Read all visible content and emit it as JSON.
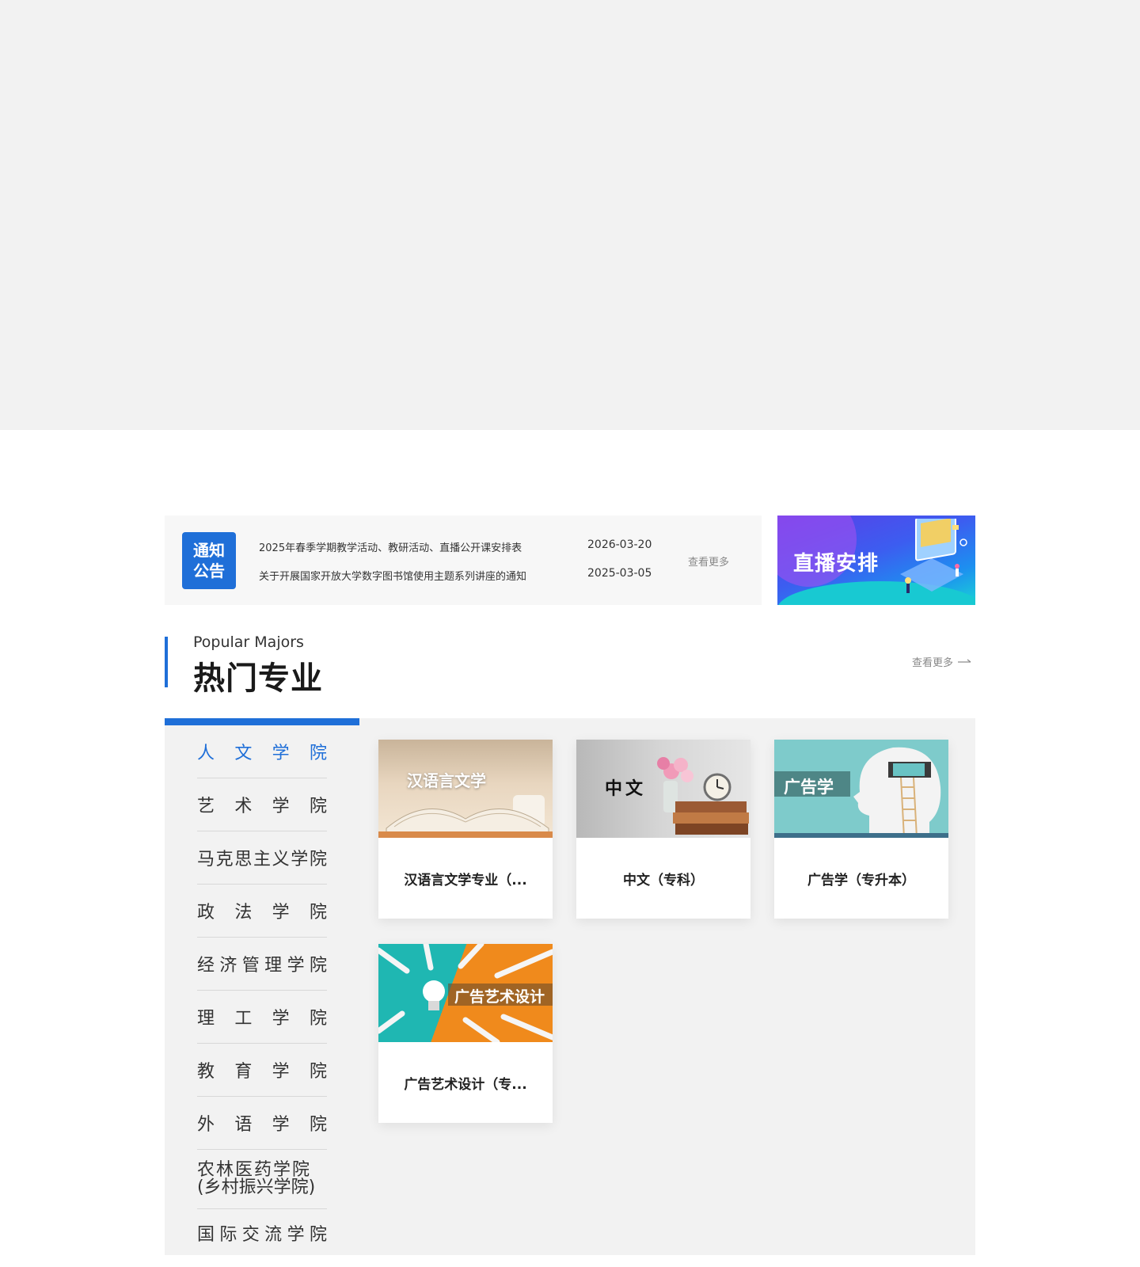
{
  "notice": {
    "badge_line1": "通知",
    "badge_line2": "公告",
    "items": [
      {
        "title": "2025年春季学期教学活动、教研活动、直播公开课安排表",
        "date": "2026-03-20"
      },
      {
        "title": "关于开展国家开放大学数字图书馆使用主题系列讲座的通知",
        "date": "2025-03-05"
      }
    ],
    "more_label": "查看更多"
  },
  "live_banner": {
    "title": "直播安排"
  },
  "section": {
    "subtitle": "Popular Majors",
    "title": "热门专业",
    "more_label": "查看更多"
  },
  "colleges": [
    {
      "chars": [
        "人",
        "文",
        "学",
        "院"
      ],
      "active": true
    },
    {
      "chars": [
        "艺",
        "术",
        "学",
        "院"
      ]
    },
    {
      "chars": [
        "马",
        "克",
        "思",
        "主",
        "义",
        "学",
        "院"
      ]
    },
    {
      "chars": [
        "政",
        "法",
        "学",
        "院"
      ]
    },
    {
      "chars": [
        "经",
        "济",
        "管",
        "理",
        "学",
        "院"
      ]
    },
    {
      "chars": [
        "理",
        "工",
        "学",
        "院"
      ]
    },
    {
      "chars": [
        "教",
        "育",
        "学",
        "院"
      ]
    },
    {
      "chars": [
        "外",
        "语",
        "学",
        "院"
      ]
    },
    {
      "line1": "农林医药学院",
      "line2": "(乡村振兴学院)"
    },
    {
      "chars": [
        "国",
        "际",
        "交",
        "流",
        "学",
        "院"
      ]
    }
  ],
  "majors": [
    {
      "thumb_label": "汉语言文学",
      "caption": "汉语言文学专业（..."
    },
    {
      "thumb_label": "中文",
      "caption": "中文（专科）"
    },
    {
      "thumb_label": "广告学",
      "caption": "广告学（专升本）"
    },
    {
      "thumb_label": "广告艺术设计",
      "caption": "广告艺术设计（专..."
    }
  ],
  "colors": {
    "accent": "#1f6fd8",
    "panel_bg": "#f2f2f2"
  }
}
